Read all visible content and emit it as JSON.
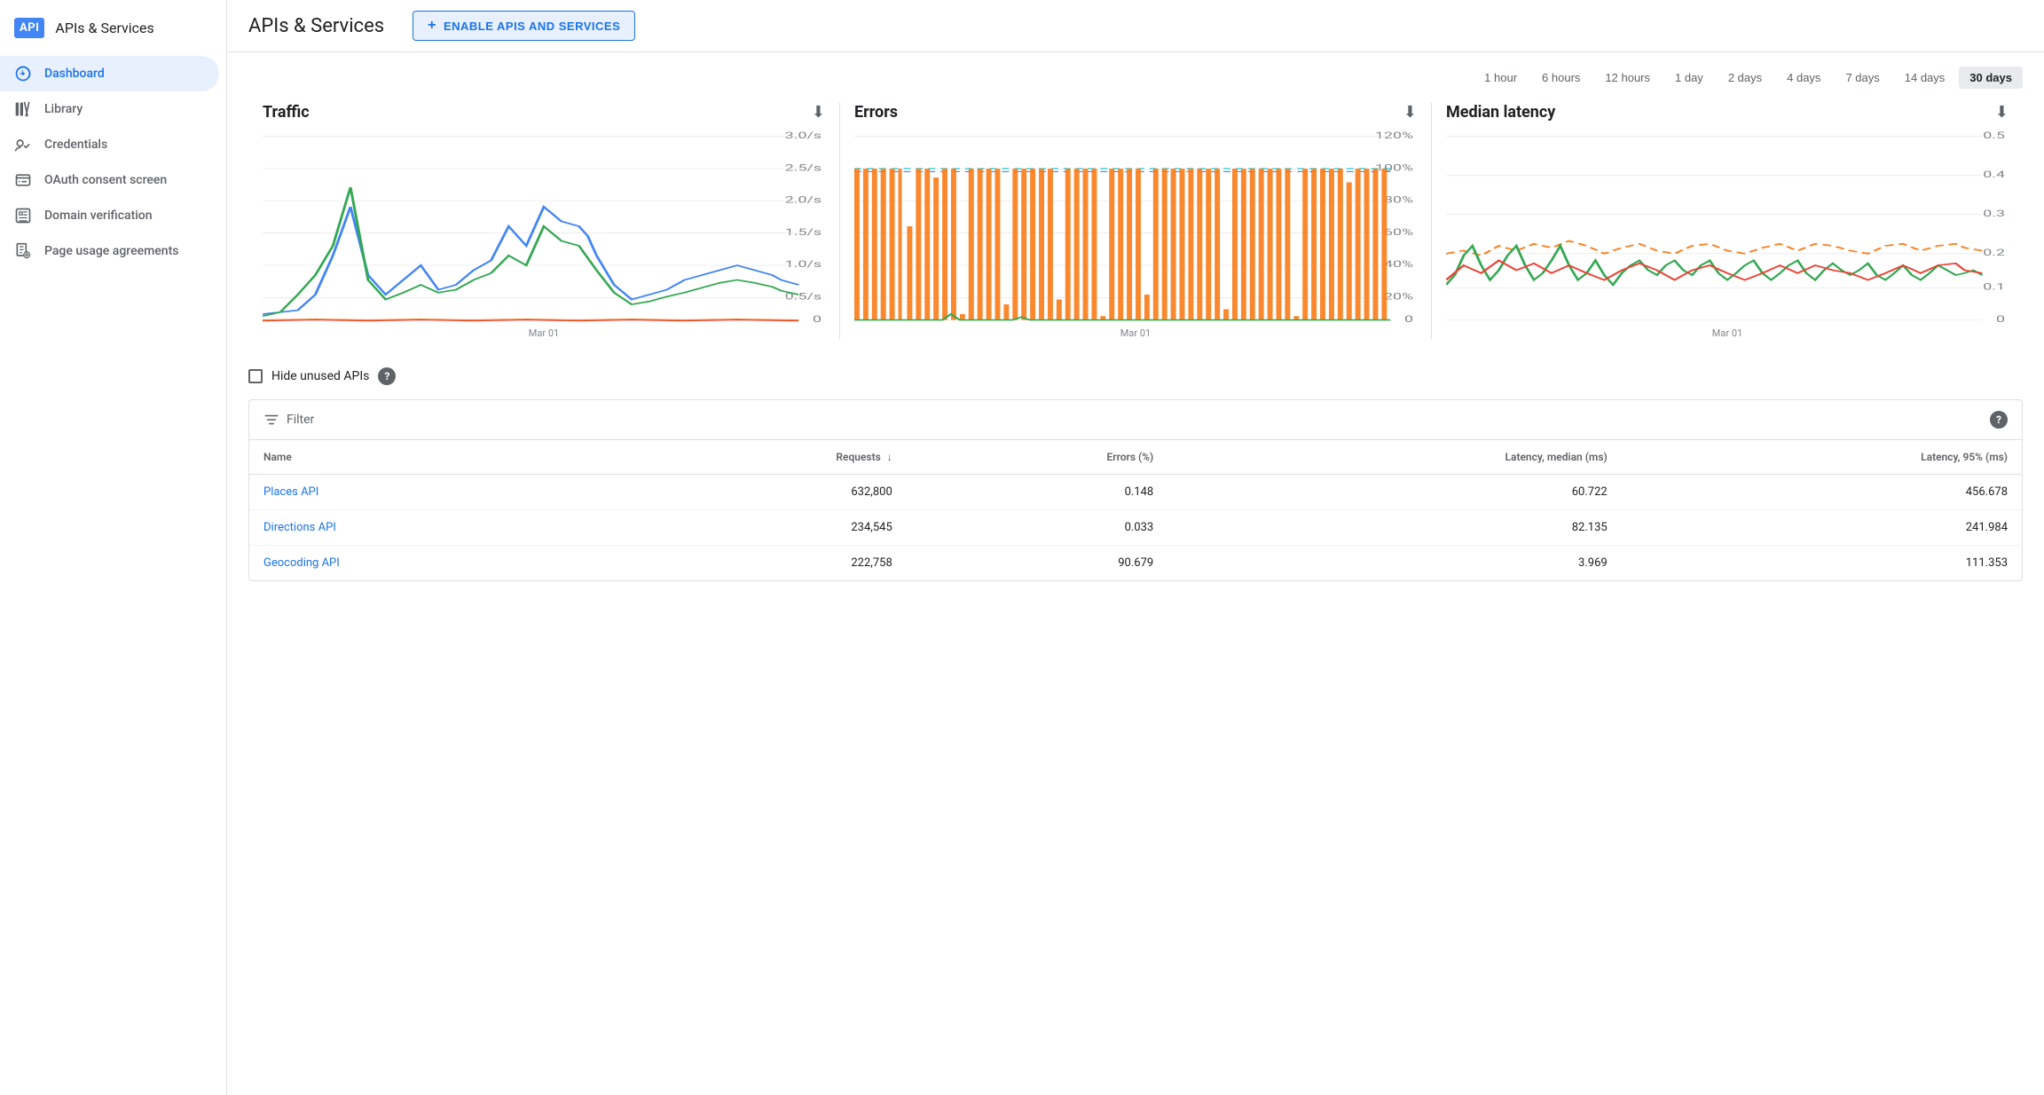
{
  "app": {
    "logo_text": "API",
    "title": "APIs & Services"
  },
  "sidebar": {
    "items": [
      {
        "id": "dashboard",
        "label": "Dashboard",
        "active": true
      },
      {
        "id": "library",
        "label": "Library",
        "active": false
      },
      {
        "id": "credentials",
        "label": "Credentials",
        "active": false
      },
      {
        "id": "oauth",
        "label": "OAuth consent screen",
        "active": false
      },
      {
        "id": "domain",
        "label": "Domain verification",
        "active": false
      },
      {
        "id": "page-usage",
        "label": "Page usage agreements",
        "active": false
      }
    ]
  },
  "header": {
    "title": "APIs & Services",
    "enable_btn": "ENABLE APIS AND SERVICES"
  },
  "time_range": {
    "options": [
      "1 hour",
      "6 hours",
      "12 hours",
      "1 day",
      "2 days",
      "4 days",
      "7 days",
      "14 days",
      "30 days"
    ],
    "active": "30 days"
  },
  "charts": [
    {
      "id": "traffic",
      "title": "Traffic",
      "x_label": "Mar 01",
      "y_labels": [
        "3.0/s",
        "2.5/s",
        "2.0/s",
        "1.5/s",
        "1.0/s",
        "0.5/s",
        "0"
      ]
    },
    {
      "id": "errors",
      "title": "Errors",
      "x_label": "Mar 01",
      "y_labels": [
        "120%",
        "100%",
        "80%",
        "60%",
        "40%",
        "20%",
        "0"
      ]
    },
    {
      "id": "latency",
      "title": "Median latency",
      "x_label": "Mar 01",
      "y_labels": [
        "0.5",
        "0.4",
        "0.3",
        "0.2",
        "0.1",
        "0"
      ]
    }
  ],
  "filter": {
    "hide_unused_label": "Hide unused APIs",
    "filter_label": "Filter",
    "help_text": "?"
  },
  "table": {
    "columns": [
      {
        "id": "name",
        "label": "Name",
        "sortable": false
      },
      {
        "id": "requests",
        "label": "Requests",
        "sortable": true
      },
      {
        "id": "errors",
        "label": "Errors (%)",
        "sortable": false
      },
      {
        "id": "latency_median",
        "label": "Latency, median (ms)",
        "sortable": false
      },
      {
        "id": "latency_95",
        "label": "Latency, 95% (ms)",
        "sortable": false
      }
    ],
    "rows": [
      {
        "name": "Places API",
        "requests": "632,800",
        "errors": "0.148",
        "latency_median": "60.722",
        "latency_95": "456.678"
      },
      {
        "name": "Directions API",
        "requests": "234,545",
        "errors": "0.033",
        "latency_median": "82.135",
        "latency_95": "241.984"
      },
      {
        "name": "Geocoding API",
        "requests": "222,758",
        "errors": "90.679",
        "latency_median": "3.969",
        "latency_95": "111.353"
      }
    ]
  }
}
